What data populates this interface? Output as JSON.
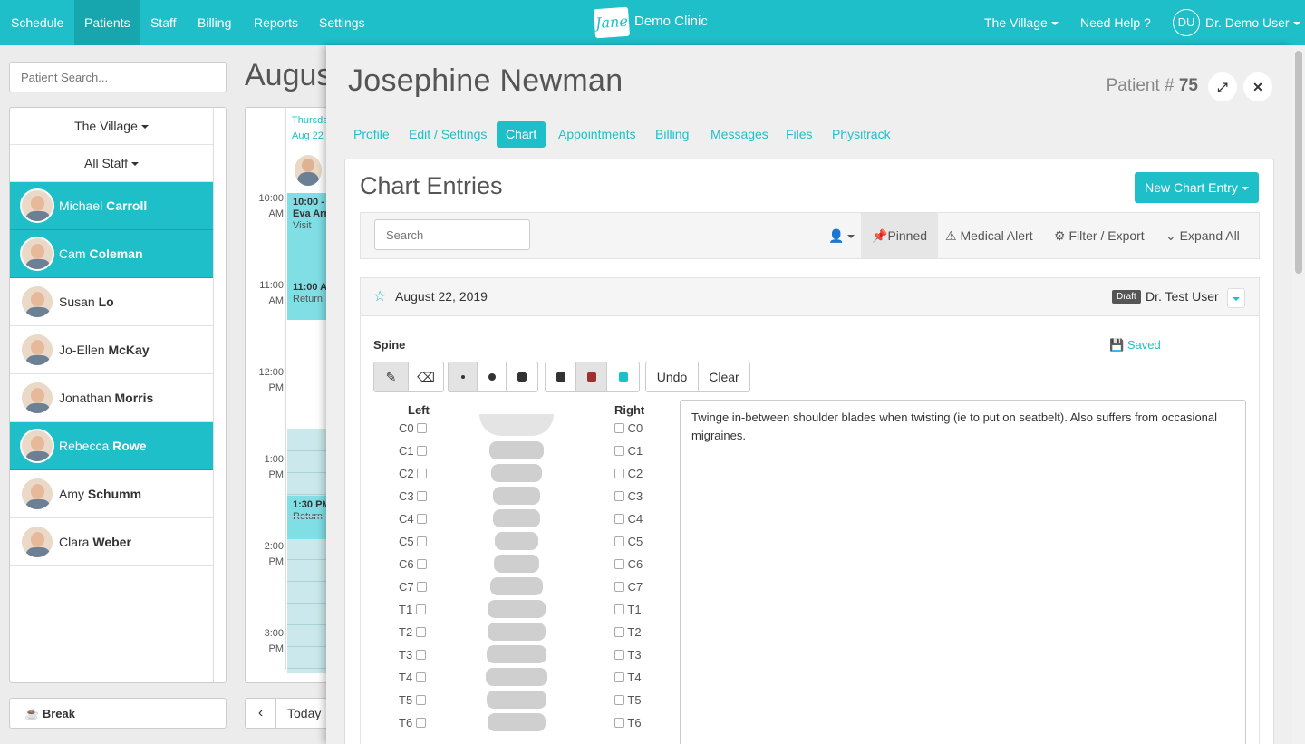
{
  "topnav": {
    "items": [
      "Schedule",
      "Patients",
      "Staff",
      "Billing",
      "Reports",
      "Settings"
    ],
    "active": "Patients",
    "logo_text": "Jane",
    "clinic_name": "Demo Clinic",
    "location": "The Village",
    "help": "Need Help ?",
    "user_initials": "DU",
    "user_name": "Dr. Demo User"
  },
  "sidebar": {
    "search_placeholder": "Patient Search...",
    "location_filter": "The Village",
    "staff_filter": "All Staff",
    "staff": [
      {
        "first": "Michael",
        "last": "Carroll",
        "selected": true
      },
      {
        "first": "Cam",
        "last": "Coleman",
        "selected": true
      },
      {
        "first": "Susan",
        "last": "Lo",
        "selected": false
      },
      {
        "first": "Jo-Ellen",
        "last": "McKay",
        "selected": false
      },
      {
        "first": "Jonathan",
        "last": "Morris",
        "selected": false
      },
      {
        "first": "Rebecca",
        "last": "Rowe",
        "selected": true
      },
      {
        "first": "Amy",
        "last": "Schumm",
        "selected": false
      },
      {
        "first": "Clara",
        "last": "Weber",
        "selected": false
      }
    ],
    "break_label": "Break"
  },
  "calendar": {
    "title": "Augus",
    "day_line1": "Thursda",
    "day_line2": "Aug 22",
    "times": [
      {
        "t": "10:00",
        "ap": "AM"
      },
      {
        "t": "11:00",
        "ap": "AM"
      },
      {
        "t": "12:00",
        "ap": "PM"
      },
      {
        "t": "1:00",
        "ap": "PM"
      },
      {
        "t": "2:00",
        "ap": "PM"
      },
      {
        "t": "3:00",
        "ap": "PM"
      }
    ],
    "appointments": [
      {
        "time": "10:00 -",
        "name": "Eva Arr",
        "type": "Visit"
      },
      {
        "time": "11:00 A",
        "name": "",
        "type": "Return"
      },
      {
        "time": "1:30 PM",
        "name": "",
        "type": "Return"
      }
    ],
    "today_label": "Today"
  },
  "patient": {
    "name": "Josephine Newman",
    "number_label": "Patient #",
    "number": "75",
    "tabs": [
      "Profile",
      "Edit / Settings",
      "Chart",
      "Appointments",
      "Billing",
      "Messages",
      "Files",
      "Physitrack"
    ],
    "active_tab": "Chart"
  },
  "chart": {
    "title": "Chart Entries",
    "new_entry": "New Chart Entry",
    "search_placeholder": "Search",
    "pinned": "Pinned",
    "medical_alert": "Medical Alert",
    "filter_export": "Filter / Export",
    "expand_all": "Expand All",
    "entry": {
      "date": "August 22, 2019",
      "status": "Draft",
      "author": "Dr. Test User",
      "section": "Spine",
      "saved": "Saved",
      "undo": "Undo",
      "clear": "Clear",
      "left_label": "Left",
      "right_label": "Right",
      "vertebrae": [
        "C0",
        "C1",
        "C2",
        "C3",
        "C4",
        "C5",
        "C6",
        "C7",
        "T1",
        "T2",
        "T3",
        "T4",
        "T5",
        "T6"
      ],
      "note": "Twinge in-between shoulder blades when twisting (ie to put on seatbelt). Also suffers from occasional migraines."
    },
    "colors": {
      "dark": "#333333",
      "red": "#a0302c",
      "teal": "#1fbfc9"
    }
  },
  "theme": {
    "accent": "#1fbfc9",
    "accent_dark": "#17a5ae"
  }
}
